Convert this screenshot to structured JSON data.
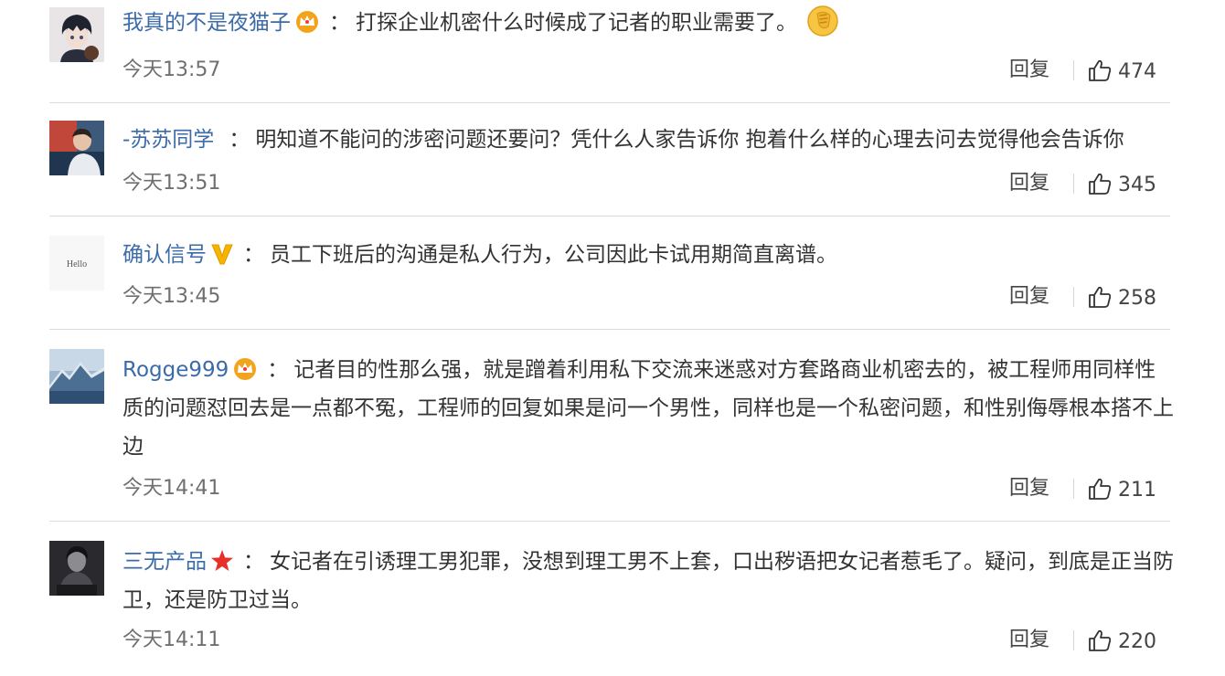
{
  "reply_label": "回复",
  "colors": {
    "username": "#3b6ba8",
    "text": "#333333",
    "meta": "#6f6f6f",
    "divider": "#dcdcdc"
  },
  "comments": [
    {
      "username": "我真的不是夜猫子",
      "badge": "crown-icon",
      "separator": "：",
      "text": "打探企业机密什么时候成了记者的职业需要了。",
      "emoji": "facepalm-emoji-icon",
      "time": "今天13:57",
      "likes": "474"
    },
    {
      "username": "-苏苏同学",
      "badge": "",
      "separator": "：",
      "text": "明知道不能问的涉密问题还要问？凭什么人家告诉你 抱着什么样的心理去问去觉得他会告诉你",
      "time": "今天13:51",
      "likes": "345"
    },
    {
      "username": "确认信号",
      "badge": "verified-v-icon",
      "separator": "：",
      "text": "员工下班后的沟通是私人行为，公司因此卡试用期简直离谱。",
      "avatar_text": "Hello",
      "time": "今天13:45",
      "likes": "258"
    },
    {
      "username": "Rogge999",
      "badge": "crown-icon",
      "separator": "：",
      "text": "记者目的性那么强，就是蹭着利用私下交流来迷惑对方套路商业机密去的，被工程师用同样性质的问题怼回去是一点都不冤，工程师的回复如果是问一个男性，同样也是一个私密问题，和性别侮辱根本搭不上边",
      "time": "今天14:41",
      "likes": "211"
    },
    {
      "username": "三无产品",
      "badge": "star-icon",
      "separator": "：",
      "text": "女记者在引诱理工男犯罪，没想到理工男不上套，口出秽语把女记者惹毛了。疑问，到底是正当防卫，还是防卫过当。",
      "time": "今天14:11",
      "likes": "220"
    }
  ]
}
